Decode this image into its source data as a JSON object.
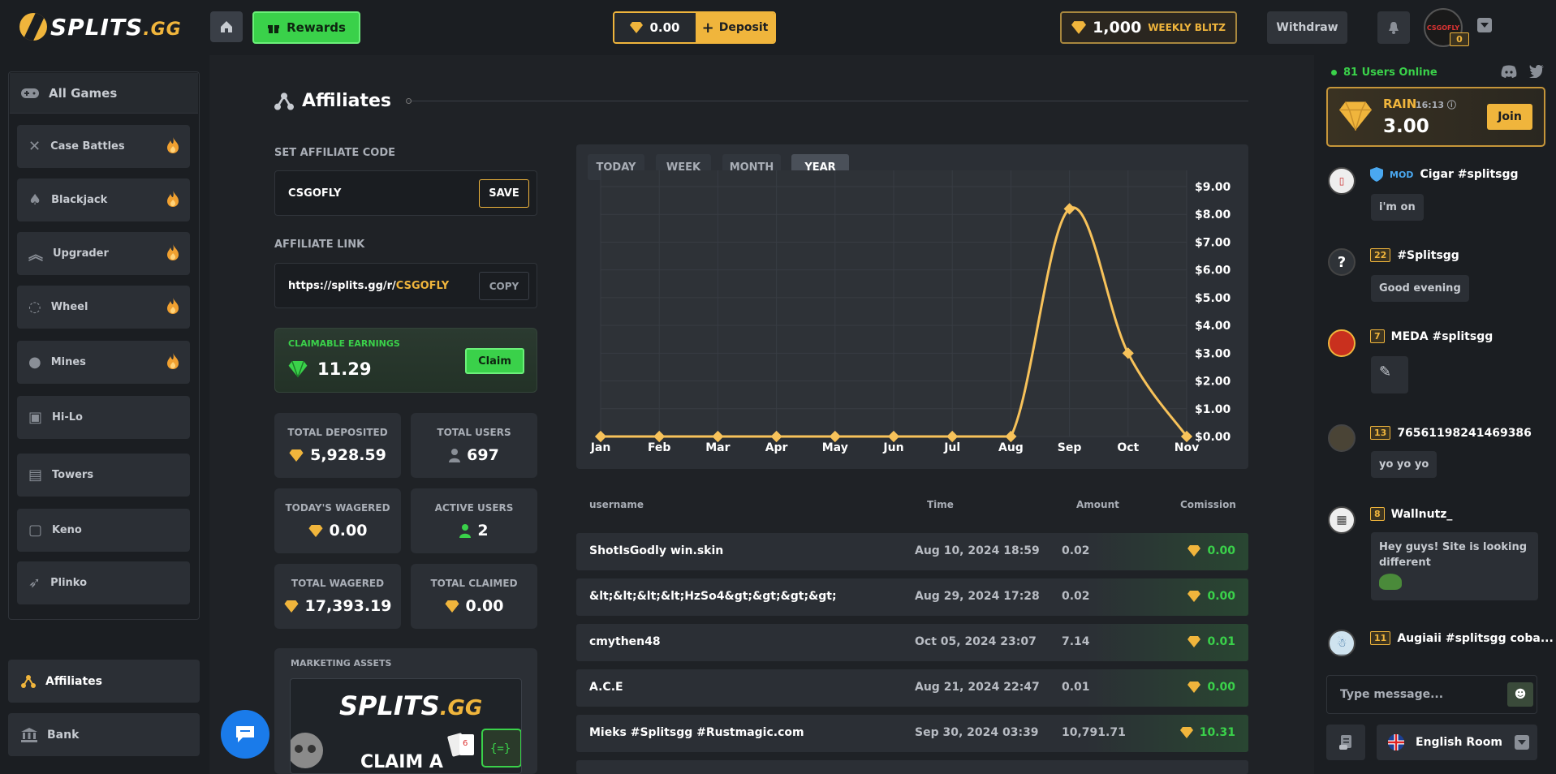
{
  "brand": {
    "name": "SPLITS",
    "tld": ".GG"
  },
  "header": {
    "rewards_label": "Rewards",
    "balance": "0.00",
    "deposit_label": "Deposit",
    "weekly_amount": "1,000",
    "weekly_label": "WEEKLY BLITZ",
    "withdraw_label": "Withdraw",
    "avatar_text": "CSGOFLY",
    "user_level": "0"
  },
  "sidebar": {
    "all_games_label": "All Games",
    "games": [
      {
        "label": "Case Battles",
        "hot": true,
        "icon": "swords-icon"
      },
      {
        "label": "Blackjack",
        "hot": true,
        "icon": "cards-icon"
      },
      {
        "label": "Upgrader",
        "hot": true,
        "icon": "chevrons-up-icon"
      },
      {
        "label": "Wheel",
        "hot": true,
        "icon": "wheel-icon"
      },
      {
        "label": "Mines",
        "hot": true,
        "icon": "mine-icon"
      },
      {
        "label": "Hi-Lo",
        "hot": false,
        "icon": "hilo-icon"
      },
      {
        "label": "Towers",
        "hot": false,
        "icon": "tower-icon"
      },
      {
        "label": "Keno",
        "hot": false,
        "icon": "keno-icon"
      },
      {
        "label": "Plinko",
        "hot": false,
        "icon": "plinko-icon"
      }
    ],
    "affiliates_label": "Affiliates",
    "bank_label": "Bank"
  },
  "affiliates": {
    "title": "Affiliates",
    "set_code_label": "SET AFFILIATE CODE",
    "code_value": "CSGOFLY",
    "save_label": "SAVE",
    "link_label": "AFFILIATE LINK",
    "link_prefix": "https://splits.gg/r/",
    "link_code": "CSGOFLY",
    "copy_label": "COPY",
    "claimable_label": "CLAIMABLE EARNINGS",
    "claimable_value": "11.29",
    "claim_label": "Claim",
    "stats": {
      "total_deposited_label": "TOTAL DEPOSITED",
      "total_deposited": "5,928.59",
      "total_users_label": "TOTAL USERS",
      "total_users": "697",
      "todays_wagered_label": "TODAY'S WAGERED",
      "todays_wagered": "0.00",
      "active_users_label": "ACTIVE USERS",
      "active_users": "2",
      "total_wagered_label": "TOTAL WAGERED",
      "total_wagered": "17,393.19",
      "total_claimed_label": "TOTAL CLAIMED",
      "total_claimed": "0.00"
    },
    "marketing_label": "MARKETING ASSETS",
    "marketing_claim": "CLAIM A"
  },
  "chart_tabs": [
    "TODAY",
    "WEEK",
    "MONTH",
    "YEAR"
  ],
  "chart_tab_active": "YEAR",
  "chart_data": {
    "type": "line",
    "categories": [
      "Jan",
      "Feb",
      "Mar",
      "Apr",
      "May",
      "Jun",
      "Jul",
      "Aug",
      "Sep",
      "Oct",
      "Nov"
    ],
    "values": [
      0,
      0,
      0,
      0,
      0,
      0,
      0,
      0,
      8.2,
      3.0,
      0
    ],
    "yticks": [
      "$0.00",
      "$1.00",
      "$2.00",
      "$3.00",
      "$4.00",
      "$5.00",
      "$6.00",
      "$7.00",
      "$8.00",
      "$9.00"
    ],
    "ylim": [
      0,
      9
    ],
    "color": "#f7c25a",
    "grid": true
  },
  "table": {
    "headers": {
      "username": "username",
      "time": "Time",
      "amount": "Amount",
      "commission": "Comission"
    },
    "rows": [
      {
        "username": "ShotIsGodly win.skin",
        "time": "Aug 10, 2024 18:59",
        "amount": "0.02",
        "commission": "0.00"
      },
      {
        "username": "&lt;&lt;&lt;&lt;HzSo4&gt;&gt;&gt;&gt;",
        "time": "Aug 29, 2024 17:28",
        "amount": "0.02",
        "commission": "0.00"
      },
      {
        "username": "cmythen48",
        "time": "Oct 05, 2024 23:07",
        "amount": "7.14",
        "commission": "0.01"
      },
      {
        "username": "A.C.E",
        "time": "Aug 21, 2024 22:47",
        "amount": "0.01",
        "commission": "0.00"
      },
      {
        "username": "Mieks #Splitsgg #Rustmagic.com",
        "time": "Sep 30, 2024 03:39",
        "amount": "10,791.71",
        "commission": "10.31"
      }
    ]
  },
  "chat": {
    "online_text": "81 Users Online",
    "rain_label": "RAIN",
    "rain_time": "16:13",
    "rain_amount": "3.00",
    "join_label": "Join",
    "messages": [
      {
        "level": "",
        "mod": "MOD",
        "name": "Cigar #splitsgg",
        "text": "i'm on"
      },
      {
        "level": "22",
        "name": "#Splitsgg",
        "text": "Good evening"
      },
      {
        "level": "7",
        "name": "MEDA #splitsgg",
        "text": ""
      },
      {
        "level": "13",
        "name": "76561198241469386",
        "text": "yo yo yo"
      },
      {
        "level": "8",
        "name": "Wallnutz_",
        "text": "Hey guys! Site is looking different"
      },
      {
        "level": "11",
        "name": "Augiaii #splitsgg coba...",
        "text": ""
      }
    ],
    "input_placeholder": "Type message...",
    "room_label": "English Room"
  },
  "colors": {
    "accent": "#f0b53c",
    "green": "#3ad14a",
    "bg": "#1f2226",
    "panel": "#2b2f35"
  }
}
